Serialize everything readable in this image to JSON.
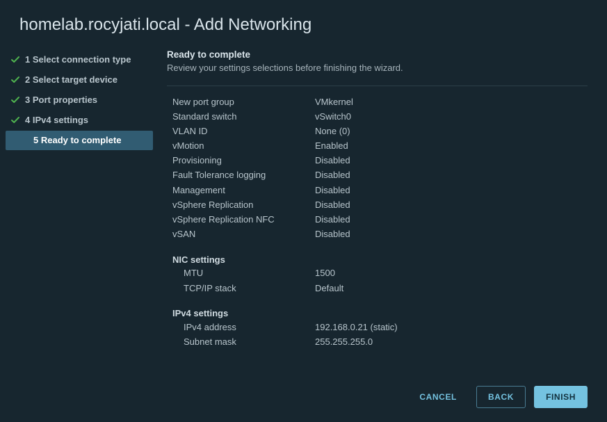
{
  "title": "homelab.rocyjati.local - Add Networking",
  "steps": [
    {
      "label": "1 Select connection type",
      "done": true
    },
    {
      "label": "2 Select target device",
      "done": true
    },
    {
      "label": "3 Port properties",
      "done": true
    },
    {
      "label": "4 IPv4 settings",
      "done": true
    },
    {
      "label": "5 Ready to complete",
      "current": true
    }
  ],
  "content": {
    "title": "Ready to complete",
    "subtitle": "Review your settings selections before finishing the wizard."
  },
  "review": {
    "rows": [
      {
        "k": "New port group",
        "v": "VMkernel"
      },
      {
        "k": "Standard switch",
        "v": "vSwitch0"
      },
      {
        "k": "VLAN ID",
        "v": "None (0)"
      },
      {
        "k": "vMotion",
        "v": "Enabled"
      },
      {
        "k": "Provisioning",
        "v": "Disabled"
      },
      {
        "k": "Fault Tolerance logging",
        "v": "Disabled"
      },
      {
        "k": "Management",
        "v": "Disabled"
      },
      {
        "k": "vSphere Replication",
        "v": "Disabled"
      },
      {
        "k": "vSphere Replication NFC",
        "v": "Disabled"
      },
      {
        "k": "vSAN",
        "v": "Disabled"
      }
    ],
    "nic_heading": "NIC settings",
    "nic": [
      {
        "k": "MTU",
        "v": "1500"
      },
      {
        "k": "TCP/IP stack",
        "v": "Default"
      }
    ],
    "ipv4_heading": "IPv4 settings",
    "ipv4": [
      {
        "k": "IPv4 address",
        "v": "192.168.0.21 (static)"
      },
      {
        "k": "Subnet mask",
        "v": "255.255.255.0"
      }
    ]
  },
  "buttons": {
    "cancel": "CANCEL",
    "back": "BACK",
    "finish": "FINISH"
  },
  "colors": {
    "check": "#4fb24f",
    "accent": "#74c2e0",
    "bg": "#17262f"
  }
}
